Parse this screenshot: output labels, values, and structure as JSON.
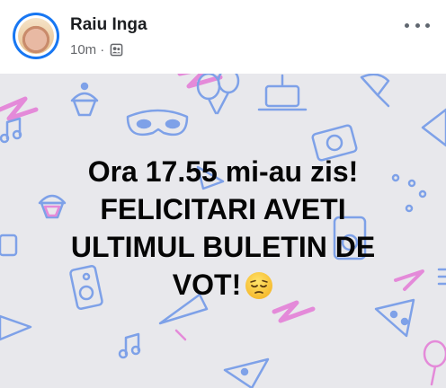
{
  "post": {
    "author_name": "Raiu Inga",
    "timestamp": "10m",
    "separator": "·",
    "audience_icon": "friends-icon",
    "more_icon": "more-horizontal-icon",
    "text_lines": [
      "Ora 17.55 mi-au zis!",
      "FELICITARI AVETI",
      "ULTIMUL BULETIN DE",
      "VOT!"
    ],
    "emoji": "pensive-face-emoji"
  },
  "colors": {
    "background": "#e8e8ec",
    "pattern_blue": "#7ea1e8",
    "pattern_pink": "#e48ad9",
    "text": "#050505",
    "meta": "#65676b",
    "avatar_ring": "#1877f2"
  }
}
